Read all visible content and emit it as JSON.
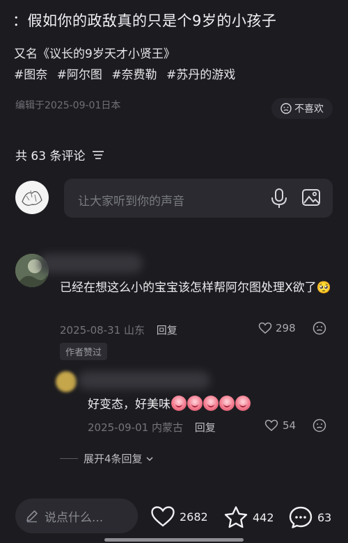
{
  "post": {
    "title": "：假如你的政敌真的只是个9岁的小孩子",
    "subtitle": "又名《议长的9岁天才小贤王》",
    "tags": [
      "#图奈",
      "#阿尔图",
      "#奈费勒",
      "#苏丹的游戏"
    ],
    "meta": "编辑于2025-09-01日本",
    "dislike_label": "不喜欢"
  },
  "comments_header": {
    "count_label": "共 63 条评论"
  },
  "comment_input": {
    "placeholder": "让大家听到你的声音"
  },
  "comments": [
    {
      "text": "已经在想这么小的宝宝该怎样帮阿尔图处理X欲了🥺",
      "date": "2025-08-31",
      "location": "山东",
      "reply_label": "回复",
      "likes": "298",
      "badge": "作者赞过"
    },
    {
      "text": "好变态，好美味",
      "emoji_count": 5,
      "date": "2025-09-01",
      "location": "内蒙古",
      "reply_label": "回复",
      "likes": "54"
    }
  ],
  "expand_label": "展开4条回复",
  "bottom_bar": {
    "say_placeholder": "说点什么...",
    "likes": "2682",
    "favorites": "442",
    "comments": "63"
  },
  "icons": [
    "dislike-face-icon",
    "sort-icon",
    "mic-icon",
    "image-icon",
    "heart-icon",
    "star-icon",
    "chat-icon",
    "pencil-icon",
    "chevron-down-icon"
  ]
}
